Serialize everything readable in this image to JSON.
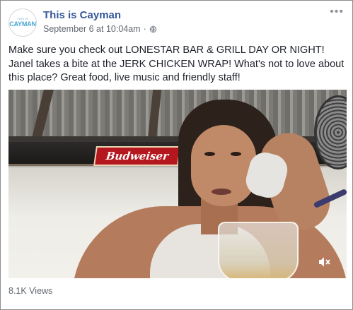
{
  "post": {
    "page_name": "This is Cayman",
    "avatar": {
      "small_text": "THIS IS",
      "main_text": "CAYMAN"
    },
    "timestamp": "September 6 at 10:04am",
    "separator": "·",
    "privacy_icon": "globe-icon",
    "more_options": "•••",
    "caption": "Make sure you check out LONESTAR BAR & GRILL DAY OR NIGHT! Janel takes a bite at the JERK CHICKEN WRAP! What's not to love about this place? Great food, live music and friendly staff!",
    "video": {
      "sign_text": "Budweiser",
      "mute_icon": "speaker-muted-icon"
    },
    "views": "8.1K Views"
  },
  "colors": {
    "page_name": "#365899",
    "meta": "#616770",
    "text": "#1d2129",
    "border": "#8d8d8d"
  }
}
